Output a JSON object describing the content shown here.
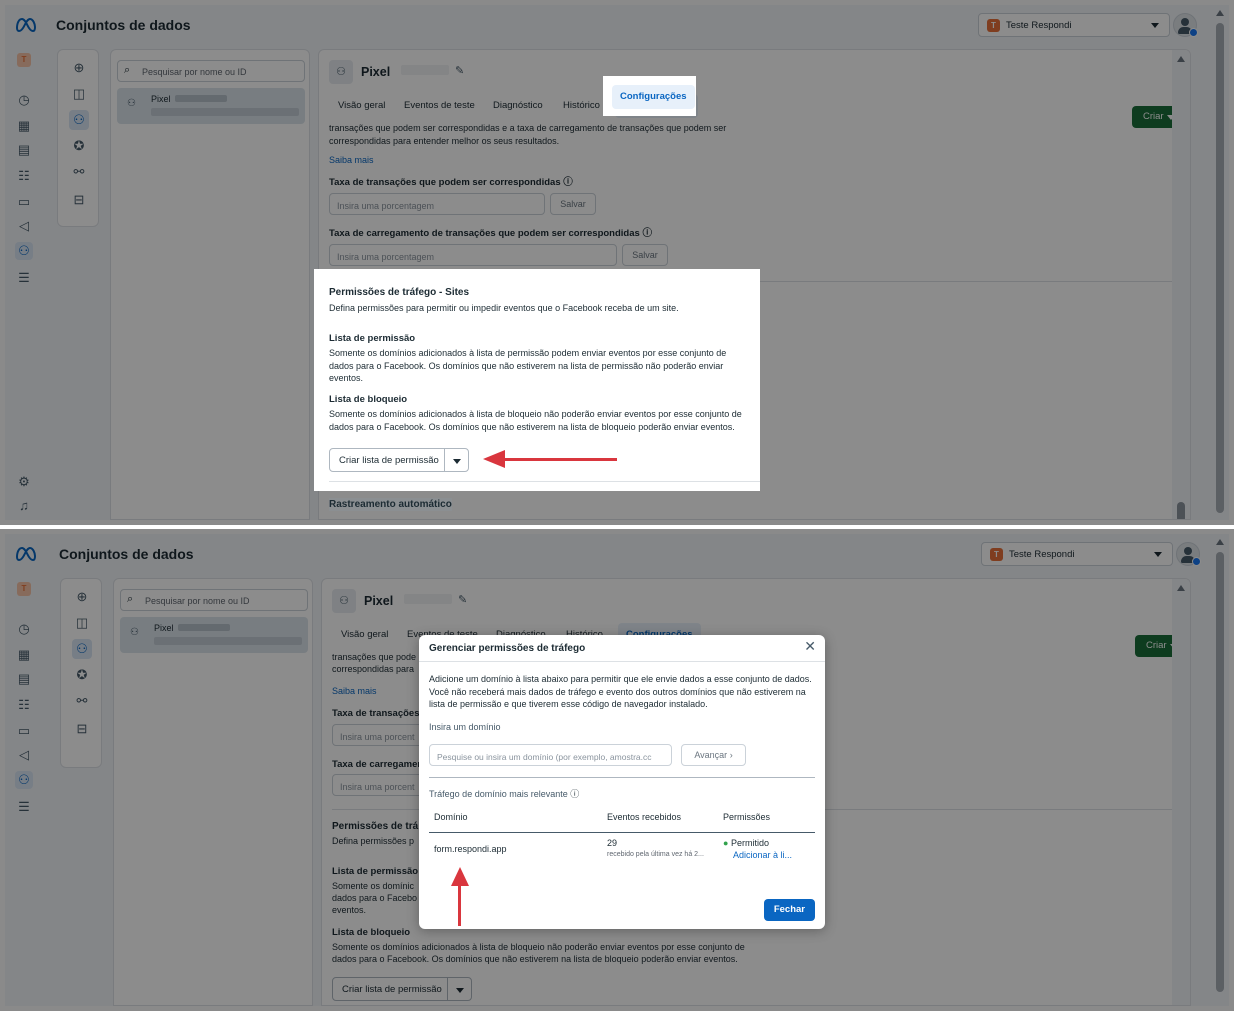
{
  "app": {
    "title": "Conjuntos de dados",
    "account_initial": "T",
    "account_name": "Teste Respondi",
    "create_label": "Criar",
    "search_placeholder": "Pesquisar por nome ou ID",
    "dataset_name": "Pixel"
  },
  "detail": {
    "name": "Pixel",
    "tabs": [
      "Visão geral",
      "Eventos de teste",
      "Diagnóstico",
      "Histórico",
      "Configurações"
    ],
    "active_tab": "Configurações"
  },
  "settings": {
    "intro_text": "transações que podem ser correspondidas e a taxa de carregamento de transações que podem ser correspondidas para entender melhor os seus resultados.",
    "intro_text_cut": "transações que pode",
    "intro_text_cut2": "correspondidas para",
    "learn_more": "Saiba mais",
    "match_rate_label": "Taxa de transações que podem ser correspondidas",
    "match_rate_cut": "Taxa de transações c",
    "upload_rate_label": "Taxa de carregamento de transações que podem ser correspondidas",
    "upload_rate_cut": "Taxa de carregamen",
    "percent_placeholder": "Insira uma porcentagem",
    "percent_cut": "Insira uma porcent",
    "save": "Salvar",
    "traffic_title": "Permissões de tráfego - Sites",
    "traffic_title_cut": "Permissões de trá",
    "traffic_desc": "Defina permissões para permitir ou impedir eventos que o Facebook receba de um site.",
    "traffic_desc_cut": "Defina permissões p",
    "allow_title": "Lista de permissão",
    "allow_desc": "Somente os domínios adicionados à lista de permissão podem enviar eventos por esse conjunto de dados para o Facebook. Os domínios que não estiverem na lista de permissão não poderão enviar eventos.",
    "allow_desc_l1": "Somente os domínic",
    "allow_desc_l2": "dados para o Facebo",
    "allow_desc_l3": "eventos.",
    "block_title": "Lista de bloqueio",
    "block_desc": "Somente os domínios adicionados à lista de bloqueio não poderão enviar eventos por esse conjunto de dados para o Facebook. Os domínios que não estiverem na lista de bloqueio poderão enviar eventos.",
    "block_desc_l1": "Somente os domínios adicionados à lista de bloqueio não poderão enviar eventos por esse conjunto de",
    "block_desc_l2": "dados para o Facebook. Os domínios que não estiverem na lista de bloqueio poderão enviar eventos.",
    "create_allow_list": "Criar lista de permissão",
    "auto_tracking": "Rastreamento automático"
  },
  "modal": {
    "title": "Gerenciar permissões de tráfego",
    "desc": "Adicione um domínio à lista abaixo para permitir que ele envie dados a esse conjunto de dados. Você não receberá mais dados de tráfego e evento dos outros domínios que não estiverem na lista de permissão e que tiverem esse código de navegador instalado.",
    "enter_domain": "Insira um domínio",
    "domain_placeholder": "Pesquise ou insira um domínio (por exemplo, amostra.cc",
    "next": "Avançar",
    "top_traffic": "Tráfego de domínio mais relevante",
    "columns": [
      "Domínio",
      "Eventos recebidos",
      "Permissões"
    ],
    "rows": [
      {
        "domain": "form.respondi.app",
        "events": "29",
        "events_sub": "recebido pela última vez há 2...",
        "status": "Permitido",
        "action": "Adicionar à li..."
      }
    ],
    "close": "Fechar"
  },
  "colors": {
    "accent": "#0a66c2",
    "create": "#1a6e3a",
    "arrow": "#d9363e",
    "allowed": "#31a24c"
  }
}
